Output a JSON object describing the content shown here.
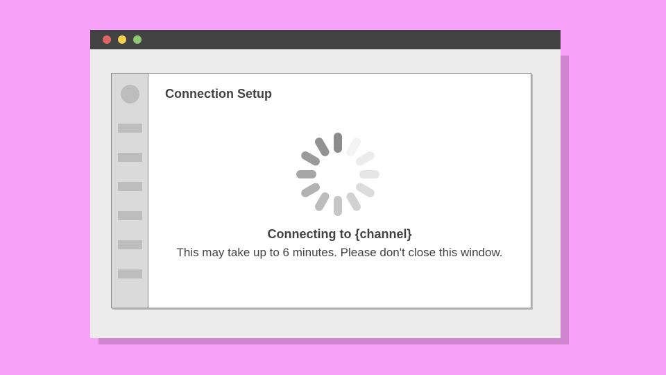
{
  "window": {
    "controls": [
      "close",
      "minimize",
      "zoom"
    ],
    "colors": {
      "close": "#e06666",
      "minimize": "#f4d04c",
      "zoom": "#8fc973",
      "titlebar": "#424242",
      "backdrop": "#f8a1f8"
    }
  },
  "sidebar": {
    "avatar_icon": "avatar-circle",
    "item_count": 6
  },
  "main": {
    "title": "Connection Setup",
    "spinner_icon": "loading-spinner-icon",
    "status_title": "Connecting to {channel}",
    "status_message": "This may take up to 6 minutes. Please don't close this window."
  }
}
